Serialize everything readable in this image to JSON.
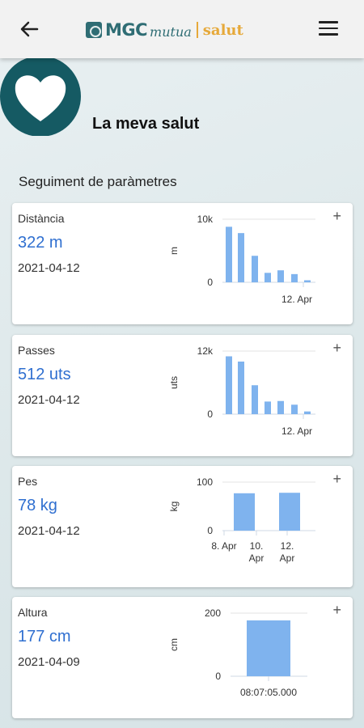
{
  "header": {
    "logo": {
      "brand": "MGC",
      "mutua": "mutua",
      "product": "salut"
    }
  },
  "profile": {
    "title": "La meva salut"
  },
  "section": {
    "title": "Seguiment de paràmetres"
  },
  "colors": {
    "accent_blue": "#2f6fd0",
    "bar_blue": "#7fb3ee",
    "brand_teal": "#2f6d74",
    "brand_gold": "#e6a93a"
  },
  "cards": [
    {
      "name": "Distància",
      "value": "322 m",
      "date": "2021-04-12",
      "add_label": "+"
    },
    {
      "name": "Passes",
      "value": "512 uts",
      "date": "2021-04-12",
      "add_label": "+"
    },
    {
      "name": "Pes",
      "value": "78 kg",
      "date": "2021-04-12",
      "add_label": "+"
    },
    {
      "name": "Altura",
      "value": "177 cm",
      "date": "2021-04-09",
      "add_label": "+"
    }
  ],
  "chart_data": [
    {
      "type": "bar",
      "ylabel": "m",
      "ylim": [
        0,
        10000
      ],
      "yticks": [
        "10k",
        "0"
      ],
      "xtick_labels": [
        "12. Apr"
      ],
      "values": [
        8800,
        7800,
        4200,
        1500,
        1900,
        1300,
        322
      ]
    },
    {
      "type": "bar",
      "ylabel": "uts",
      "ylim": [
        0,
        12000
      ],
      "yticks": [
        "12k",
        "0"
      ],
      "xtick_labels": [
        "12. Apr"
      ],
      "values": [
        11000,
        10000,
        5500,
        2400,
        2500,
        1800,
        512
      ]
    },
    {
      "type": "bar",
      "ylabel": "kg",
      "ylim": [
        0,
        100
      ],
      "yticks": [
        "100",
        "0"
      ],
      "xtick_labels": [
        "8. Apr",
        "10. Apr",
        "12. Apr"
      ],
      "values": [
        77,
        78
      ]
    },
    {
      "type": "bar",
      "ylabel": "cm",
      "ylim": [
        0,
        200
      ],
      "yticks": [
        "200",
        "0"
      ],
      "xtick_labels": [
        "08:07:05.000"
      ],
      "values": [
        177
      ]
    }
  ]
}
